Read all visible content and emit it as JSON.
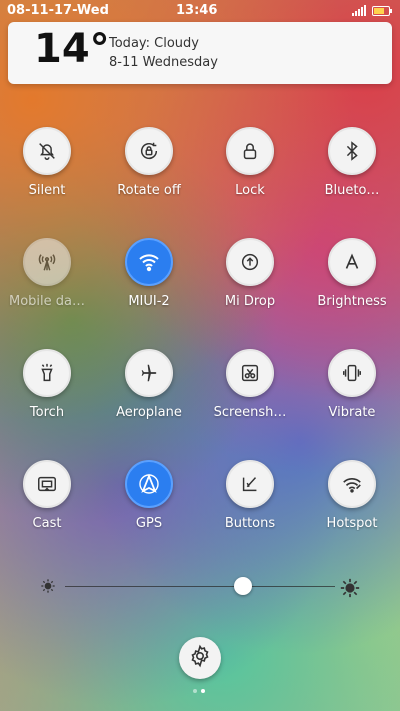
{
  "status_bar": {
    "date": "08-11-17-Wed",
    "time": "13:46",
    "battery_level": 0.7
  },
  "weather_card": {
    "temperature": "14°",
    "condition": "Today: Cloudy",
    "date": "8-11 Wednesday"
  },
  "toggles": [
    {
      "label": "Silent",
      "icon": "bell-off-icon",
      "active": false
    },
    {
      "label": "Rotate off",
      "icon": "rotate-lock-icon",
      "active": false
    },
    {
      "label": "Lock",
      "icon": "lock-icon",
      "active": false
    },
    {
      "label": "Blueto…",
      "icon": "bluetooth-icon",
      "active": false
    },
    {
      "label": "Mobile da…",
      "icon": "antenna-icon",
      "active": false,
      "disabled": true
    },
    {
      "label": "MIUI-2",
      "icon": "wifi-icon",
      "active": true
    },
    {
      "label": "Mi Drop",
      "icon": "upload-arrow-icon",
      "active": false
    },
    {
      "label": "Brightness",
      "icon": "letter-a-icon",
      "active": false
    },
    {
      "label": "Torch",
      "icon": "flashlight-icon",
      "active": false
    },
    {
      "label": "Aeroplane",
      "icon": "airplane-icon",
      "active": false
    },
    {
      "label": "Screensh…",
      "icon": "scissors-icon",
      "active": false
    },
    {
      "label": "Vibrate",
      "icon": "vibrate-icon",
      "active": false
    },
    {
      "label": "Cast",
      "icon": "cast-icon",
      "active": false
    },
    {
      "label": "GPS",
      "icon": "location-icon",
      "active": true
    },
    {
      "label": "Buttons",
      "icon": "buttons-icon",
      "active": false
    },
    {
      "label": "Hotspot",
      "icon": "hotspot-icon",
      "active": false
    }
  ],
  "brightness": {
    "level": 0.66
  },
  "pager": {
    "pages": 2,
    "current": 2
  },
  "colors": {
    "active_blue": "#2b7ef0",
    "tile_bg": "#f3f3f3"
  }
}
